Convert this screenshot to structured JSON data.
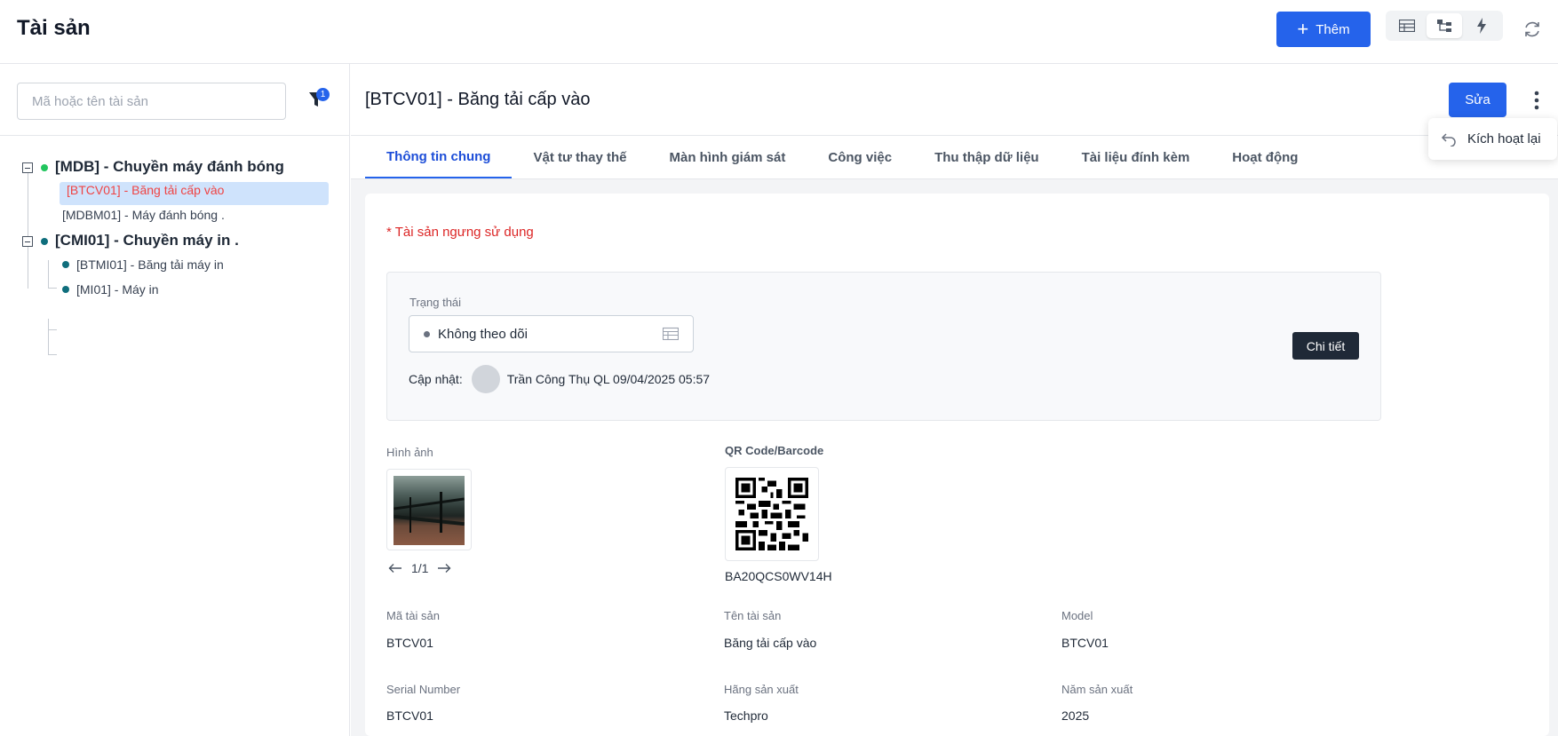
{
  "header": {
    "title": "Tài sản",
    "add_label": "Thêm"
  },
  "left": {
    "search_placeholder": "Mã hoặc tên tài sản",
    "filter_badge": "1",
    "tree": [
      {
        "label": "[MDB] - Chuyền máy đánh bóng",
        "status_color": "#22c55e"
      },
      {
        "label": "[BTCV01] - Băng tải cấp vào",
        "selected": true
      },
      {
        "label": "[MDBM01] - Máy đánh bóng ."
      },
      {
        "label": "[CMI01] - Chuyền máy in .",
        "status_color": "#0f6e7c"
      },
      {
        "label": "[BTMI01] - Băng tải máy in",
        "status_color": "#0f6e7c"
      },
      {
        "label": "[MI01] - Máy in",
        "status_color": "#0f6e7c"
      }
    ]
  },
  "detail": {
    "title": "[BTCV01] - Băng tải cấp vào",
    "edit_label": "Sửa",
    "menu_item": "Kích hoạt lại",
    "tabs": [
      "Thông tin chung",
      "Vật tư thay thế",
      "Màn hình giám sát",
      "Công việc",
      "Thu thập dữ liệu",
      "Tài liệu đính kèm",
      "Hoạt động"
    ],
    "warning": "* Tài sản ngưng sử dụng",
    "status_label": "Trạng thái",
    "status_value": "Không theo dõi",
    "updated_label": "Cập nhật:",
    "updated_value": "Trần Công Thụ QL 09/04/2025 05:57",
    "detail_button": "Chi tiết",
    "image_label": "Hình ảnh",
    "pager": "1/1",
    "qr_label": "QR Code/Barcode",
    "qr_code": "BA20QCS0WV14H",
    "fields": [
      {
        "label": "Mã tài sản",
        "value": "BTCV01"
      },
      {
        "label": "Tên tài sản",
        "value": "Băng tải cấp vào"
      },
      {
        "label": "Model",
        "value": "BTCV01"
      },
      {
        "label": "Serial Number",
        "value": "BTCV01"
      },
      {
        "label": "Hãng sản xuất",
        "value": "Techpro"
      },
      {
        "label": "Năm sản xuất",
        "value": "2025"
      }
    ]
  },
  "colors": {
    "primary": "#2563eb",
    "warning": "#dc2626",
    "selected_bg": "#cfe3fc",
    "selected_text": "#ef4444"
  }
}
